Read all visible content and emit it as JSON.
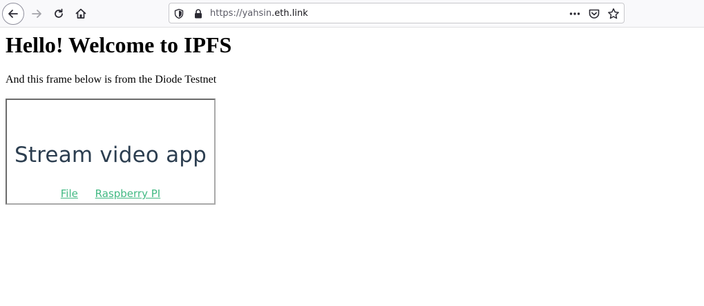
{
  "browser": {
    "url_scheme": "https://",
    "url_subdomain": "yahsin",
    "url_domain": ".eth.link"
  },
  "page": {
    "heading": "Hello! Welcome to IPFS",
    "subtitle": "And this frame below is from the Diode Testnet"
  },
  "frame": {
    "title": "Stream video app",
    "links": [
      {
        "label": "File"
      },
      {
        "label": "Raspberry PI"
      }
    ]
  },
  "colors": {
    "frame_title": "#2c3e50",
    "link": "#42b983",
    "toolbar_bg": "#f9f9fb"
  },
  "icons": {
    "back": "arrow-left-icon",
    "forward": "arrow-right-icon",
    "reload": "reload-icon",
    "home": "home-icon",
    "tracking": "shield-icon",
    "security": "lock-icon",
    "page_actions": "more-icon",
    "pocket": "pocket-icon",
    "bookmark": "star-icon"
  }
}
